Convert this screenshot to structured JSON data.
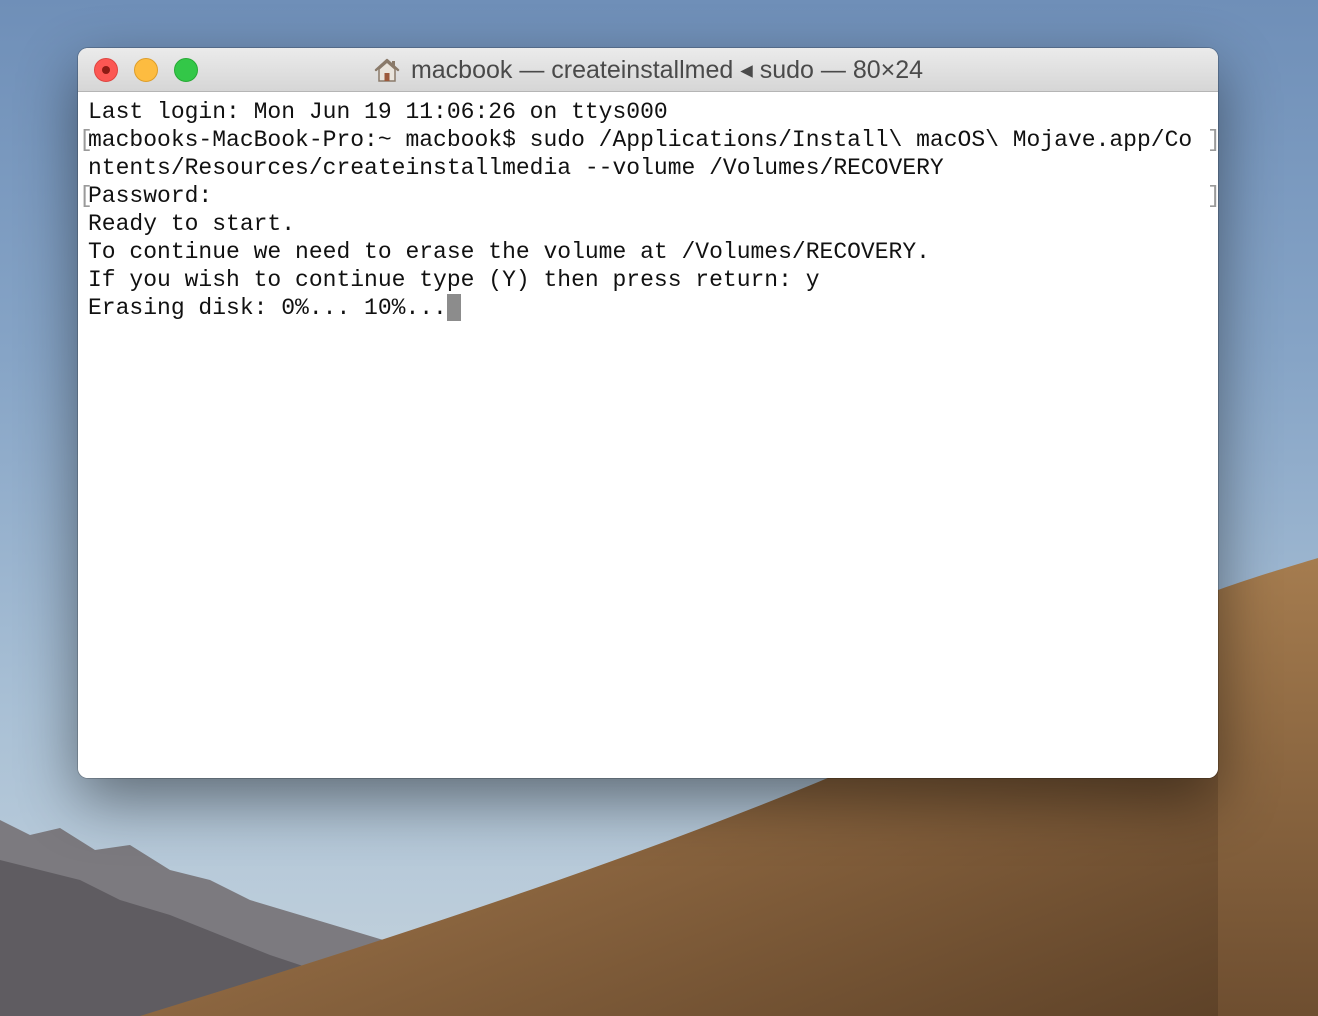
{
  "window": {
    "title": "macbook — createinstallmed ◂ sudo — 80×24",
    "home_icon": "house-icon"
  },
  "terminal": {
    "lines": [
      "Last login: Mon Jun 19 11:06:26 on ttys000",
      "macbooks-MacBook-Pro:~ macbook$ sudo /Applications/Install\\ macOS\\ Mojave.app/Co",
      "ntents/Resources/createinstallmedia --volume /Volumes/RECOVERY",
      "Password:",
      "Ready to start.",
      "To continue we need to erase the volume at /Volumes/RECOVERY.",
      "If you wish to continue type (Y) then press return: y",
      "Erasing disk: 0%... 10%..."
    ]
  },
  "colors": {
    "close": "#fc5753",
    "minimize": "#fdbc40",
    "zoom": "#33c748",
    "cursor": "#8c8c8c"
  }
}
